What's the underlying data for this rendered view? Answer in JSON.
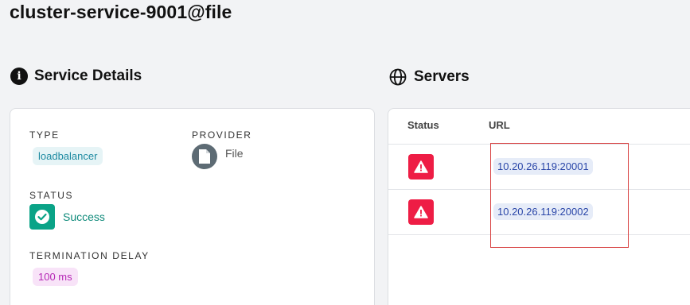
{
  "page": {
    "title": "cluster-service-9001@file"
  },
  "details": {
    "heading": "Service Details",
    "heading_icon": "info-icon",
    "type_label": "TYPE",
    "type_value": "loadbalancer",
    "provider_label": "PROVIDER",
    "provider_value": "File",
    "provider_icon": "file-icon",
    "status_label": "STATUS",
    "status_value": "Success",
    "status_icon": "check-circle-icon",
    "termination_label": "TERMINATION DELAY",
    "termination_value": "100 ms"
  },
  "servers": {
    "heading": "Servers",
    "heading_icon": "globe-icon",
    "columns": {
      "status": "Status",
      "url": "URL"
    },
    "rows": [
      {
        "status_icon": "warning-icon",
        "url": "10.20.26.119:20001"
      },
      {
        "status_icon": "warning-icon",
        "url": "10.20.26.119:20002"
      }
    ]
  },
  "colors": {
    "success": "#0aa387",
    "error": "#ee1d45",
    "url_chip": "#e6ecf8",
    "highlight": "#d84343"
  }
}
